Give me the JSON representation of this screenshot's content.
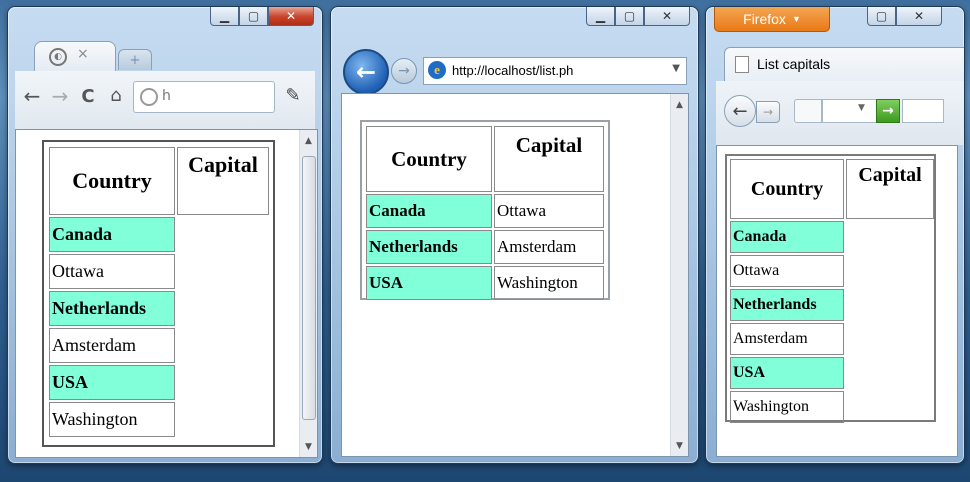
{
  "chrome": {
    "add_tab": "+",
    "address_partial": "h",
    "wrench": "🔧"
  },
  "ie": {
    "url": "http://localhost/list.ph"
  },
  "firefox": {
    "menu_label": "Firefox",
    "tab_title": "List capitals"
  },
  "table": {
    "header_country": "Country",
    "header_capital": "Capital",
    "rows": [
      {
        "country": "Canada",
        "capital": "Ottawa"
      },
      {
        "country": "Netherlands",
        "capital": "Amsterdam"
      },
      {
        "country": "USA",
        "capital": "Washington"
      }
    ]
  },
  "colors": {
    "country_highlight": "#80ffd9",
    "close_button": "#c7432a",
    "firefox_orange": "#e97a17"
  }
}
